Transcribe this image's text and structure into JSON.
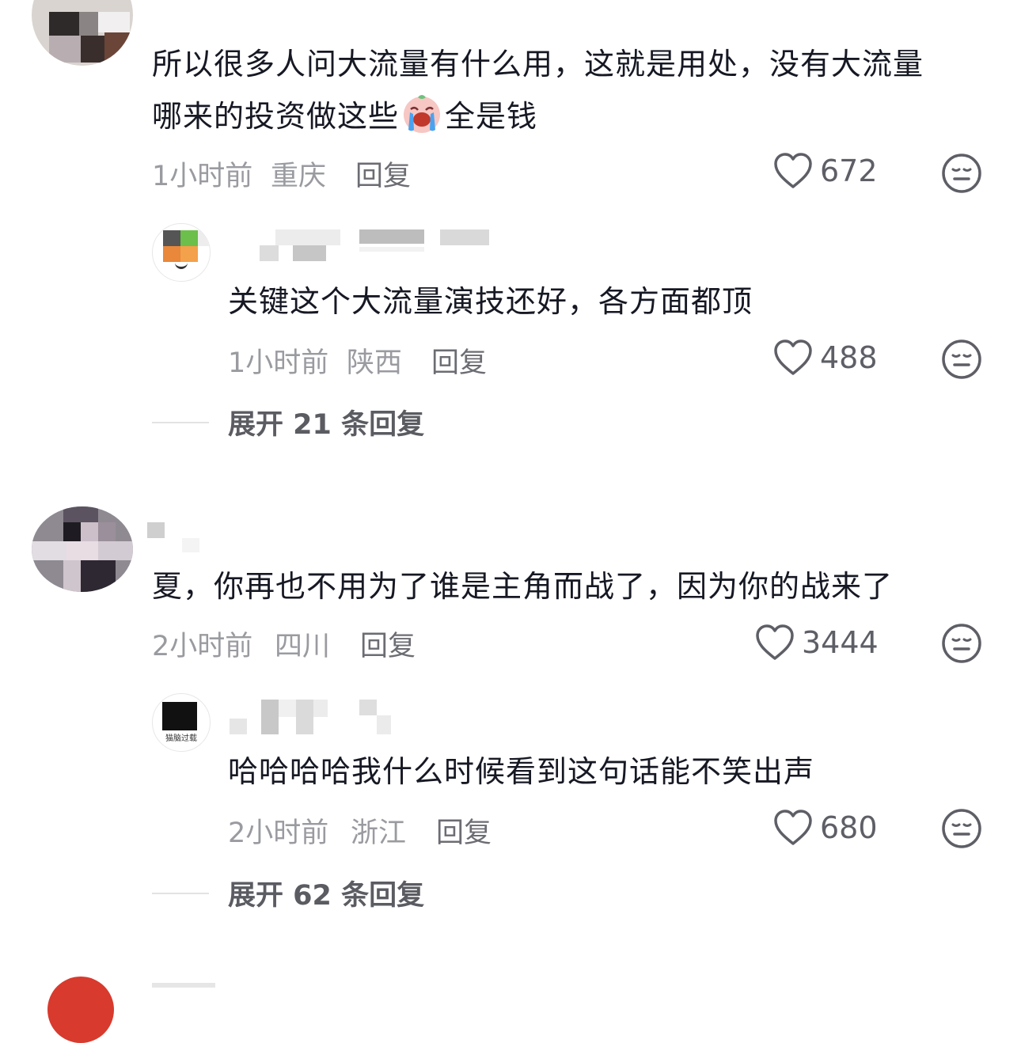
{
  "comments": [
    {
      "text_line1": "所以很多人问大流量有什么用，这就是用处，没有大流量",
      "text_line2_before": "哪来的投资做这些",
      "emoji": "crying-face-emoji",
      "text_line2_after": "全是钱",
      "time": "1小时前",
      "location": "重庆",
      "reply_label": "回复",
      "likes": "672",
      "replies": [
        {
          "text": "关键这个大流量演技还好，各方面都顶",
          "time": "1小时前",
          "location": "陕西",
          "reply_label": "回复",
          "likes": "488"
        }
      ],
      "expand_label": "展开 21 条回复"
    },
    {
      "text": "夏，你再也不用为了谁是主角而战了，因为你的战来了",
      "time": "2小时前",
      "location": "四川",
      "reply_label": "回复",
      "likes": "3444",
      "replies": [
        {
          "text": "哈哈哈哈我什么时候看到这句话能不笑出声",
          "avatar_caption": "猫脑过载",
          "time": "2小时前",
          "location": "浙江",
          "reply_label": "回复",
          "likes": "680"
        }
      ],
      "expand_label": "展开 62 条回复"
    }
  ],
  "icons": {
    "like": "heart-outline-icon",
    "dislike": "meh-face-icon"
  },
  "colors": {
    "text": "#161823",
    "meta": "#9a9ba0",
    "like_icon": "#5e5f66"
  }
}
